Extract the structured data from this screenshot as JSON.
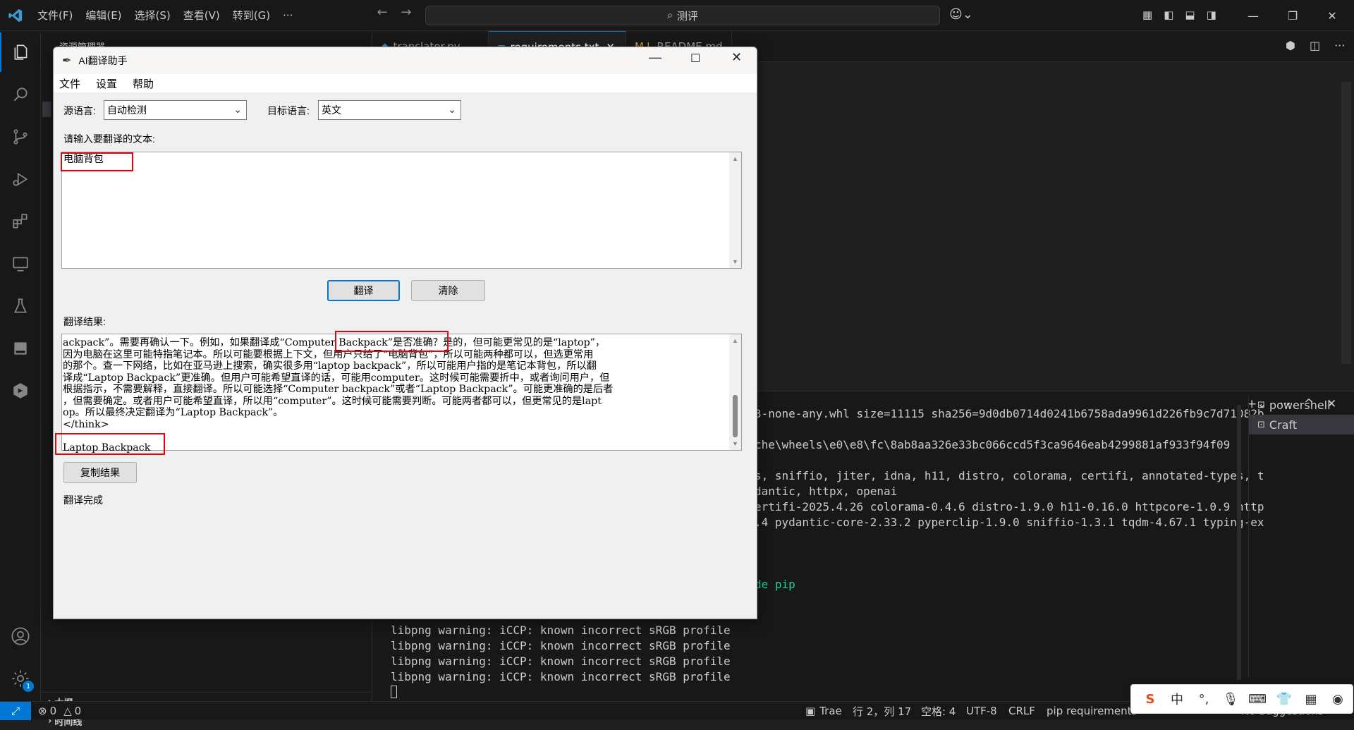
{
  "vscode": {
    "menu": [
      "文件(F)",
      "编辑(E)",
      "选择(S)",
      "查看(V)",
      "转到(G)",
      "···"
    ],
    "search": "测评",
    "tabs": [
      "translator.py",
      "requirements.txt",
      "README.md"
    ],
    "sidebar": {
      "explorer_title": "资源管理器",
      "outline": "大纲",
      "timeline": "时间线"
    },
    "terminal": {
      "lines": [
        "3-none-any.whl size=11115 sha256=9d0db0714d0241b6758ada9961d226fb9c7d71082b",
        "che\\wheels\\e0\\e8\\fc\\8ab8aa326e33bc066ccd5f3ca9646eab4299881af933f94f09",
        "s, sniffio, jiter, idna, h11, distro, colorama, certifi, annotated-types, t",
        "dantic, httpx, openai",
        "ertifi-2025.4.26 colorama-0.4.6 distro-1.9.0 h11-0.16.0 httpcore-1.0.9 http",
        ".4 pydantic-core-2.33.2 pyperclip-1.9.0 sniffio-1.3.1 tqdm-4.67.1 typing-ex",
        "de pip",
        "libpng warning: iCCP: known incorrect sRGB profile",
        "libpng warning: iCCP: known incorrect sRGB profile",
        "libpng warning: iCCP: known incorrect sRGB profile",
        "libpng warning: iCCP: known incorrect sRGB profile"
      ],
      "sessions": [
        "powershell",
        "Craft"
      ]
    },
    "status": {
      "errors": "0",
      "warnings": "0",
      "trae": "Trae",
      "position": "行 2，列 17",
      "spaces": "空格: 4",
      "encoding": "UTF-8",
      "eol": "CRLF",
      "language": "pip requirements",
      "suggestions": "No Suggestions",
      "badge": "1"
    },
    "ime": {
      "mode": "中"
    }
  },
  "translator": {
    "title": "AI翻译助手",
    "menu": [
      "文件",
      "设置",
      "帮助"
    ],
    "source_label": "源语言:",
    "source_value": "自动检测",
    "target_label": "目标语言:",
    "target_value": "英文",
    "input_label": "请输入要翻译的文本:",
    "input_text": "电脑背包",
    "translate_button": "翻译",
    "clear_button": "清除",
    "result_label": "翻译结果:",
    "result_lines": [
      "ackpack”。需要再确认一下。例如，如果翻译成“Computer Backpack”是否准确？是的，但可能更常见的是“laptop”，",
      "因为电脑在这里可能特指笔记本。所以可能要根据上下文，但用户只给了“电脑背包”，所以可能两种都可以，但选更常用",
      "的那个。查一下网络，比如在亚马逊上搜索，确实很多用“laptop backpack”，所以可能用户指的是笔记本背包，所以翻",
      "译成“Laptop Backpack”更准确。但用户可能希望直译的话，可能用computer。这时候可能需要折中，或者询问用户，但",
      "根据指示，不需要解释，直接翻译。所以可能选择“Computer backpack”或者“Laptop Backpack”。可能更准确的是后者",
      "，但需要确定。或者用户可能希望直译，所以用“computer”。这时候可能需要判断。可能两者都可以，但更常见的是lapt",
      "op。所以最终决定翻译为“Laptop Backpack”。",
      "</think>",
      "",
      "Laptop Backpack"
    ],
    "copy_button": "复制结果",
    "status": "翻译完成"
  }
}
